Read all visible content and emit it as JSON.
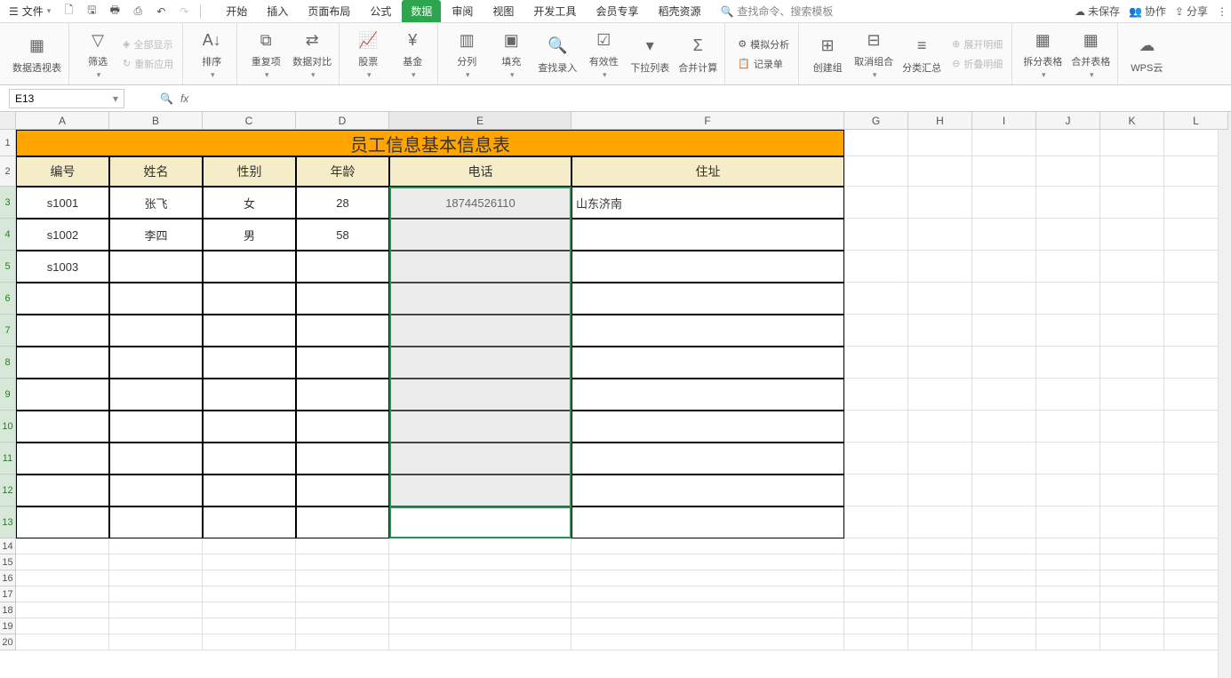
{
  "menu": {
    "file": "文件",
    "tabs": [
      "开始",
      "插入",
      "页面布局",
      "公式",
      "数据",
      "审阅",
      "视图",
      "开发工具",
      "会员专享",
      "稻壳资源"
    ],
    "active_tab": 4,
    "search_placeholder": "查找命令、搜索模板",
    "unsaved": "未保存",
    "collab": "协作",
    "share": "分享"
  },
  "ribbon": {
    "pivot": "数据透视表",
    "filter": "筛选",
    "show_all": "全部显示",
    "reapply": "重新应用",
    "sort": "排序",
    "dup": "重复项",
    "compare": "数据对比",
    "stock": "股票",
    "fund": "基金",
    "split": "分列",
    "fill": "填充",
    "findrec": "查找录入",
    "validity": "有效性",
    "droplist": "下拉列表",
    "consol": "合并计算",
    "form": "记录单",
    "sim": "模拟分析",
    "group": "创建组",
    "ungroup": "取消组合",
    "subtotal": "分类汇总",
    "expand": "展开明细",
    "collapse": "折叠明细",
    "splittable": "拆分表格",
    "mergetable": "合并表格",
    "wps": "WPS云"
  },
  "namebox": "E13",
  "columns": [
    "A",
    "B",
    "C",
    "D",
    "E",
    "F",
    "G",
    "H",
    "I",
    "J",
    "K",
    "L"
  ],
  "table": {
    "title": "员工信息基本信息表",
    "headers": [
      "编号",
      "姓名",
      "性别",
      "年龄",
      "电话",
      "住址"
    ],
    "rows": [
      [
        "s1001",
        "张飞",
        "女",
        "28",
        "18744526110",
        "山东济南"
      ],
      [
        "s1002",
        "李四",
        "男",
        "58",
        "",
        ""
      ],
      [
        "s1003",
        "",
        "",
        "",
        "",
        ""
      ]
    ]
  }
}
